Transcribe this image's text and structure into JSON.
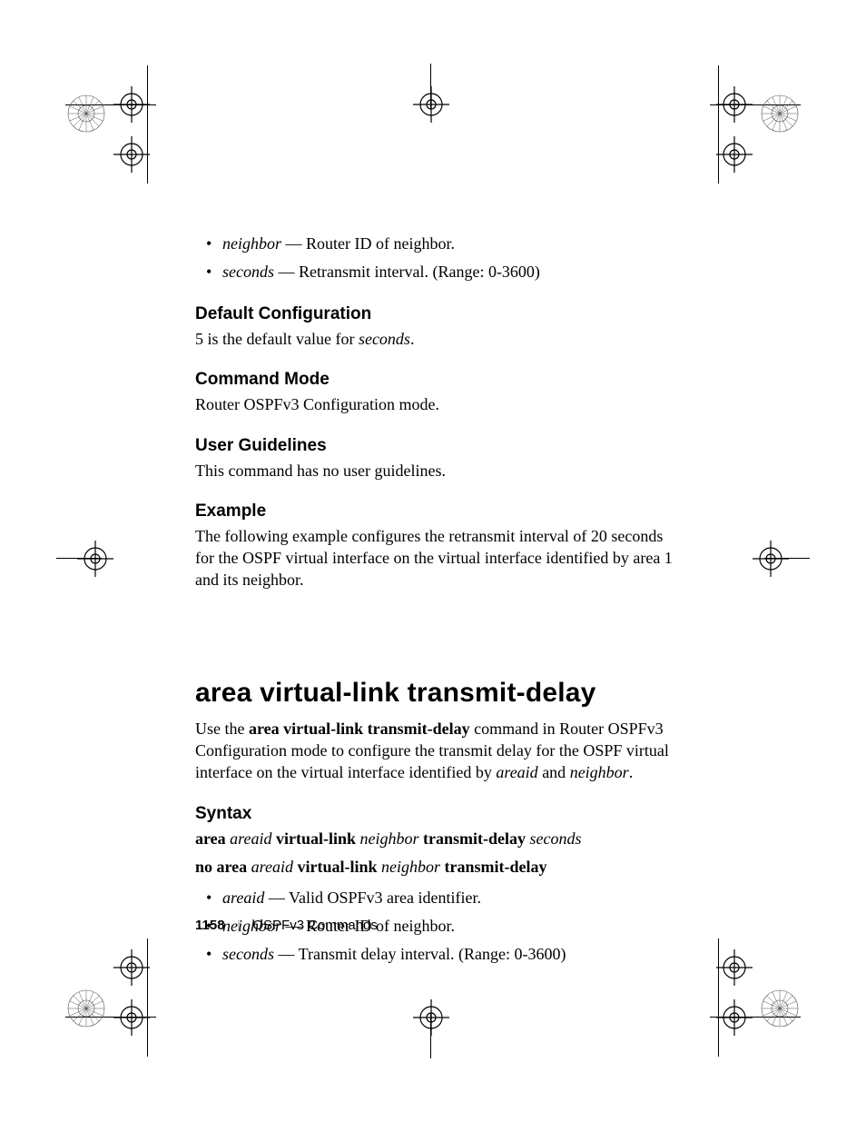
{
  "top_bullets": [
    {
      "term": "neighbor",
      "desc": " — Router ID of neighbor."
    },
    {
      "term": "seconds",
      "desc": " — Retransmit interval. (Range: 0-3600)"
    }
  ],
  "sections": {
    "default_config": {
      "heading": "Default Configuration",
      "text_before": "5 is the default value for ",
      "italic": "seconds",
      "text_after": "."
    },
    "command_mode": {
      "heading": "Command Mode",
      "text": "Router OSPFv3 Configuration mode."
    },
    "user_guidelines": {
      "heading": "User Guidelines",
      "text": "This command has no user guidelines."
    },
    "example": {
      "heading": "Example",
      "text": "The following example configures the retransmit interval of 20 seconds for the OSPF virtual interface on the virtual interface identified by area 1 and its neighbor."
    }
  },
  "command": {
    "title": "area virtual-link transmit-delay",
    "intro_parts": {
      "p1": "Use the ",
      "b1": "area virtual-link transmit-delay",
      "p2": " command in Router OSPFv3 Configuration mode to configure the transmit delay for the OSPF virtual interface on the virtual interface identified by ",
      "i1": "areaid",
      "p3": " and ",
      "i2": "neighbor",
      "p4": "."
    },
    "syntax_heading": "Syntax",
    "syntax1": {
      "b1": "area ",
      "i1": "areaid",
      "sp1": "  ",
      "b2": "virtual-link ",
      "i2": "neighbor ",
      "b3": "transmit-delay ",
      "i3": "seconds"
    },
    "syntax2": {
      "b1": "no area ",
      "i1": "areaid",
      "sp1": "  ",
      "b2": "virtual-link ",
      "i2": "neighbor ",
      "b3": "transmit-delay"
    },
    "params": [
      {
        "term": "areaid",
        "desc": " — Valid OSPFv3 area identifier."
      },
      {
        "term": "neighbor",
        "desc": " — Router ID of neighbor."
      },
      {
        "term": "seconds",
        "desc": " — Transmit delay interval. (Range: 0-3600)"
      }
    ]
  },
  "footer": {
    "page_number": "1158",
    "section": "OSPFv3 Commands"
  }
}
